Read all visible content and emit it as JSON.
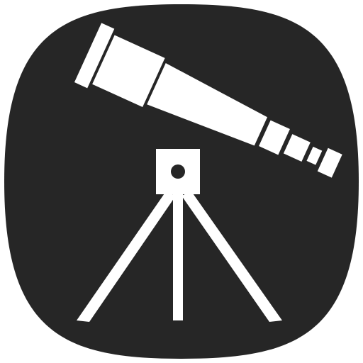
{
  "app_icon": {
    "name": "telescope-icon",
    "colors": {
      "tile": "#262626",
      "glyph": "#ffffff",
      "background": "#ffffff"
    }
  }
}
